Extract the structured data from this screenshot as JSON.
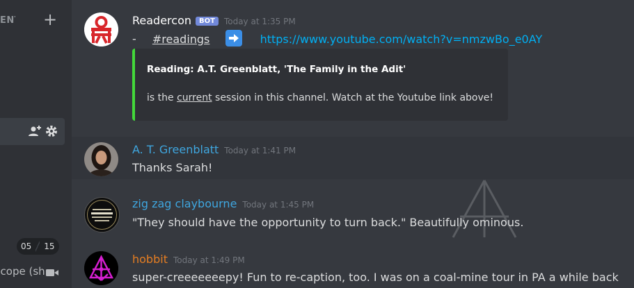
{
  "sidebar": {
    "section_label": "EVENTS",
    "add_label": "+",
    "counter": {
      "current": "05",
      "total": "15"
    },
    "voice_channel": "Scope (sh..."
  },
  "messages": [
    {
      "author": "Readercon",
      "author_color": "#ffffff",
      "badge": "BOT",
      "timestamp": "Today at 1:35 PM",
      "prefix": "-",
      "channel": "#readings",
      "link": "https://www.youtube.com/watch?v=nmzwBo_e0AY",
      "embed": {
        "title": "Reading: A.T. Greenblatt, 'The Family in the Adit'",
        "desc_before": "is the ",
        "desc_link": "current",
        "desc_after": " session in this channel. Watch at the Youtube link above!",
        "border_color": "#43d93a"
      }
    },
    {
      "author": "A. T. Greenblatt",
      "author_color": "#3fa7e0",
      "timestamp": "Today at 1:41 PM",
      "text": "Thanks Sarah!"
    },
    {
      "author": "zig zag claybourne",
      "author_color": "#3fa7e0",
      "timestamp": "Today at 1:45 PM",
      "text": "\"They should have the opportunity to turn back.\"  Beautifully ominous.",
      "avatar_text": "SAVING THE UNIVERSE ONE LADY AT A TIME"
    },
    {
      "author": "hobbit",
      "author_color": "#e67e22",
      "timestamp": "Today at 1:49 PM",
      "text": "super-creeeeeeepy!   Fun to re-caption, too.   I was on a coal-mine tour in PA a while back"
    }
  ]
}
